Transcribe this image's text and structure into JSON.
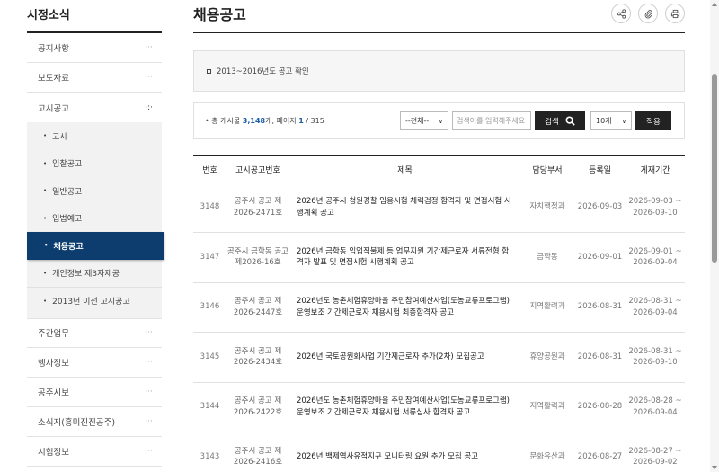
{
  "sidebar": {
    "title": "시정소식",
    "items_top": [
      {
        "label": "공지사항"
      },
      {
        "label": "보도자료"
      }
    ],
    "open_item": {
      "label": "고시공고"
    },
    "submenu": [
      {
        "label": "고시"
      },
      {
        "label": "입찰공고"
      },
      {
        "label": "일반공고"
      },
      {
        "label": "입법예고"
      },
      {
        "label": "채용공고"
      },
      {
        "label": "개인정보 제3자제공"
      },
      {
        "label": "2013년 이전 고시공고"
      }
    ],
    "items_bottom": [
      {
        "label": "주간업무"
      },
      {
        "label": "행사정보"
      },
      {
        "label": "공주시보"
      },
      {
        "label": "소식지(흥미진진공주)"
      },
      {
        "label": "시험정보"
      }
    ],
    "dots": "···",
    "open_dots": "·:·",
    "bullet": "•"
  },
  "main": {
    "title": "채용공고",
    "icons": [
      "share-icon",
      "clip-icon",
      "print-icon"
    ],
    "notice": "2013~2016년도 공고 확인",
    "count": {
      "prefix": "총 게시물",
      "total": "3,148",
      "mid": "개, 페이지",
      "page": "1",
      "pages": "/ 315"
    },
    "search": {
      "scope": "--전체--",
      "placeholder": "검색어를 입력해주세요",
      "button": "검색",
      "per_page": "10개",
      "apply": "적용"
    },
    "table": {
      "headers": [
        "번호",
        "고시공고번호",
        "제목",
        "담당부서",
        "등록일",
        "게재기간"
      ],
      "rows": [
        {
          "num": "3148",
          "code": "공주시 공고 제2026-2471호",
          "title": "2026년 공주시 청원경찰 임용시험 체력검정 합격자 및 면접시험 시행계획 공고",
          "dept": "자치행정과",
          "date": "2026-09-03",
          "period": "2026-09-03 ~ 2026-09-10"
        },
        {
          "num": "3147",
          "code": "공주시 금학동 공고 제2026-16호",
          "title": "2026년 금학동 임업직불제 등 업무지원 기간제근로자 서류전형 합격자 발표 및 면접시험 시행계획 공고",
          "dept": "금학동",
          "date": "2026-09-01",
          "period": "2026-09-01 ~ 2026-09-04"
        },
        {
          "num": "3146",
          "code": "공주시 공고 제2026-2447호",
          "title": "2026년도 농촌체험휴양마을 주민참여예산사업(도농교류프로그램) 운영보조 기간제근로자 채용시험 최종합격자 공고",
          "dept": "지역활력과",
          "date": "2026-08-31",
          "period": "2026-08-31 ~ 2026-09-04"
        },
        {
          "num": "3145",
          "code": "공주시 공고 제2026-2434호",
          "title": "2026년 국토공원화사업 기간제근로자 추가(2차) 모집공고",
          "dept": "휴양공원과",
          "date": "2026-08-31",
          "period": "2026-08-31 ~ 2026-09-10"
        },
        {
          "num": "3144",
          "code": "공주시 공고 제2026-2422호",
          "title": "2026년도 농촌체험휴양마을 주민참여예산사업(도농교류프로그램) 운영보조 기간제근로자 채용시험 서류심사 합격자 공고",
          "dept": "지역활력과",
          "date": "2026-08-28",
          "period": "2026-08-28 ~ 2026-09-04"
        },
        {
          "num": "3143",
          "code": "공주시 공고 제2026-2416호",
          "title": "2026년 백제역사유적지구 모니터링 요원 추가 모집 공고",
          "dept": "문화유산과",
          "date": "2026-08-27",
          "period": "2026-08-27 ~ 2026-09-02"
        }
      ]
    }
  }
}
